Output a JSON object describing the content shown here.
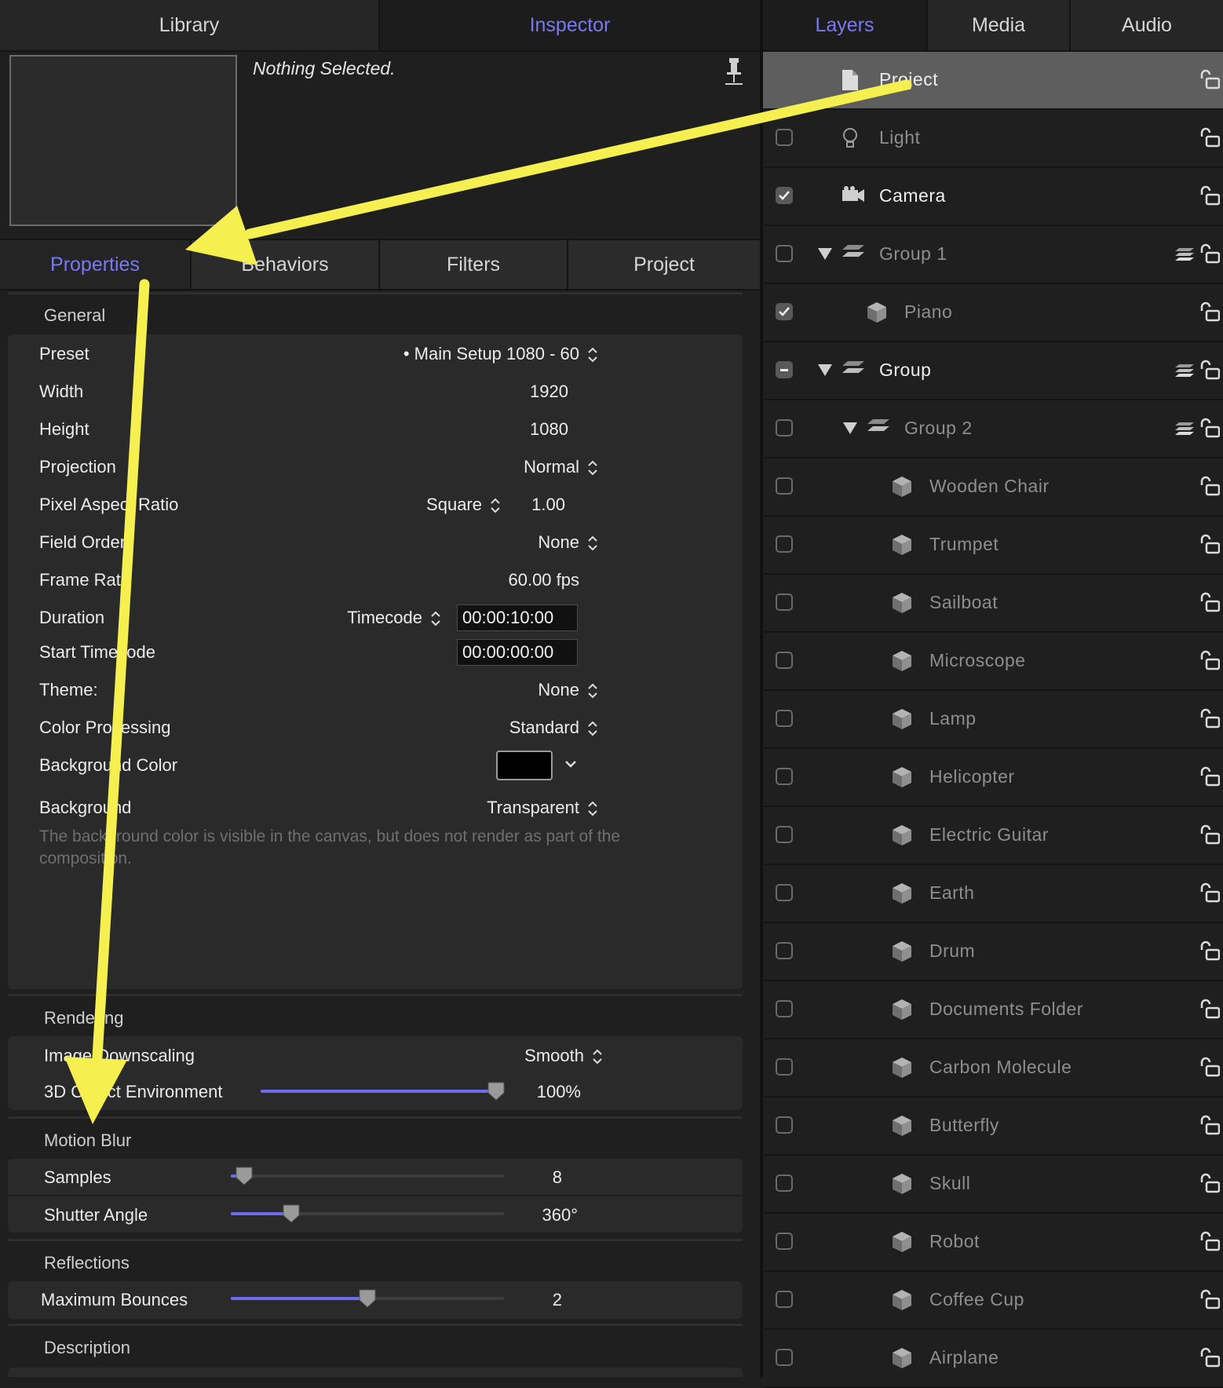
{
  "top_tabs": {
    "library": "Library",
    "inspector": "Inspector",
    "layers": "Layers",
    "media": "Media",
    "audio": "Audio"
  },
  "inspector": {
    "nothing_selected": "Nothing Selected.",
    "subtabs": [
      "Properties",
      "Behaviors",
      "Filters",
      "Project"
    ],
    "general": {
      "title": "General",
      "preset_label": "Preset",
      "preset_value": "• Main Setup 1080 - 60",
      "width_label": "Width",
      "width_value": "1920",
      "height_label": "Height",
      "height_value": "1080",
      "projection_label": "Projection",
      "projection_value": "Normal",
      "par_label": "Pixel Aspect Ratio",
      "par_mode": "Square",
      "par_value": "1.00",
      "field_order_label": "Field Order",
      "field_order_value": "None",
      "frame_rate_label": "Frame Rate",
      "frame_rate_value": "60.00 fps",
      "duration_label": "Duration",
      "duration_mode": "Timecode",
      "duration_value": "00:00:10:00",
      "start_tc_label": "Start Timecode",
      "start_tc_value": "00:00:00:00",
      "theme_label": "Theme:",
      "theme_value": "None",
      "color_proc_label": "Color Processing",
      "color_proc_value": "Standard",
      "bg_color_label": "Background Color",
      "bg_color_hex": "#000000",
      "background_label": "Background",
      "background_value": "Transparent",
      "note": "The background color is visible in the canvas, but does not render as part of the composition."
    },
    "rendering": {
      "title": "Rendering",
      "downscaling_label": "Image Downscaling",
      "downscaling_value": "Smooth",
      "env_label": "3D Object Environment",
      "env_value": "100%",
      "env_level": 1.0
    },
    "motion_blur": {
      "title": "Motion Blur",
      "samples_label": "Samples",
      "samples_value": "8",
      "samples_level": 0.05,
      "shutter_label": "Shutter Angle",
      "shutter_value": "360°",
      "shutter_level": 0.22
    },
    "reflections": {
      "title": "Reflections",
      "bounces_label": "Maximum Bounces",
      "bounces_value": "2",
      "bounces_level": 0.5
    },
    "description": {
      "title": "Description"
    }
  },
  "layers": [
    {
      "name": "Project",
      "checkbox": "none",
      "icon": "document-icon"
    },
    {
      "name": "Light",
      "checkbox": "off",
      "icon": "light-icon"
    },
    {
      "name": "Camera",
      "checkbox": "on",
      "icon": "camera-icon"
    },
    {
      "name": "Group 1",
      "checkbox": "off",
      "icon": "group-icon"
    },
    {
      "name": "Piano",
      "checkbox": "on",
      "icon": "cube-icon"
    },
    {
      "name": "Group",
      "checkbox": "mixed",
      "icon": "group-icon"
    },
    {
      "name": "Group 2",
      "checkbox": "off",
      "icon": "group-icon"
    },
    {
      "name": "Wooden Chair",
      "checkbox": "off",
      "icon": "cube-icon"
    },
    {
      "name": "Trumpet",
      "checkbox": "off",
      "icon": "cube-icon"
    },
    {
      "name": "Sailboat",
      "checkbox": "off",
      "icon": "cube-icon"
    },
    {
      "name": "Microscope",
      "checkbox": "off",
      "icon": "cube-icon"
    },
    {
      "name": "Lamp",
      "checkbox": "off",
      "icon": "cube-icon"
    },
    {
      "name": "Helicopter",
      "checkbox": "off",
      "icon": "cube-icon"
    },
    {
      "name": "Electric Guitar",
      "checkbox": "off",
      "icon": "cube-icon"
    },
    {
      "name": "Earth",
      "checkbox": "off",
      "icon": "cube-icon"
    },
    {
      "name": "Drum",
      "checkbox": "off",
      "icon": "cube-icon"
    },
    {
      "name": "Documents Folder",
      "checkbox": "off",
      "icon": "cube-icon"
    },
    {
      "name": "Carbon Molecule",
      "checkbox": "off",
      "icon": "cube-icon"
    },
    {
      "name": "Butterfly",
      "checkbox": "off",
      "icon": "cube-icon"
    },
    {
      "name": "Skull",
      "checkbox": "off",
      "icon": "cube-icon"
    },
    {
      "name": "Robot",
      "checkbox": "off",
      "icon": "cube-icon"
    },
    {
      "name": "Coffee Cup",
      "checkbox": "off",
      "icon": "cube-icon"
    },
    {
      "name": "Airplane",
      "checkbox": "off",
      "icon": "cube-icon"
    }
  ],
  "colors": {
    "accent": "#7a78f2",
    "annotation_arrow": "#f5ef50"
  }
}
